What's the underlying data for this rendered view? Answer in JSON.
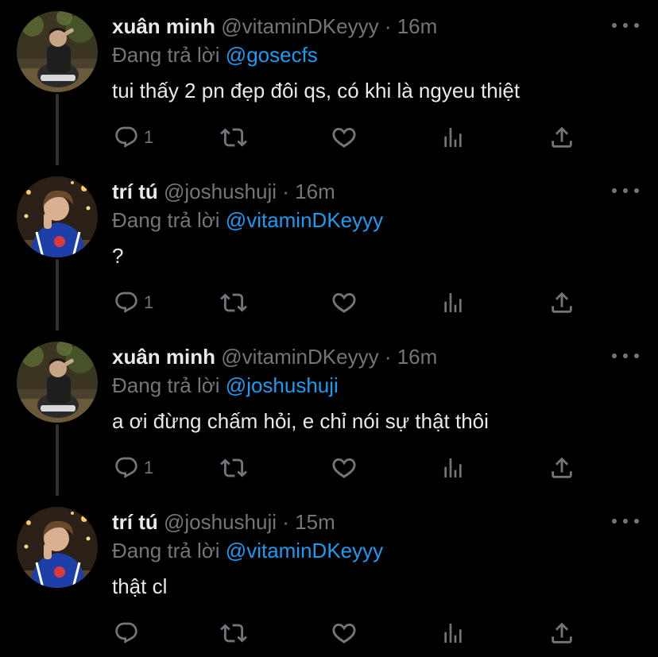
{
  "labels": {
    "replying_to": "Đang trả lời",
    "dot": "·"
  },
  "colors": {
    "background": "#000000",
    "accent": "#1d9bf0",
    "muted": "#71767b",
    "text": "#e7e9ea"
  },
  "tweets": [
    {
      "name": "xuân minh",
      "handle": "@vitaminDKeyyy",
      "time": "16m",
      "reply_to": "@gosecfs",
      "text": "tui thấy 2 pn đẹp đôi qs, có khi là ngyeu thiệt",
      "reply_count": "1"
    },
    {
      "name": "trí tú",
      "handle": "@joshushuji",
      "time": "16m",
      "reply_to": "@vitaminDKeyyy",
      "text": "?",
      "reply_count": "1"
    },
    {
      "name": "xuân minh",
      "handle": "@vitaminDKeyyy",
      "time": "16m",
      "reply_to": "@joshushuji",
      "text": "a ơi đừng chấm hỏi, e chỉ nói sự thật thôi",
      "reply_count": "1"
    },
    {
      "name": "trí tú",
      "handle": "@joshushuji",
      "time": "15m",
      "reply_to": "@vitaminDKeyyy",
      "text": "thật cl",
      "reply_count": ""
    }
  ],
  "icons": {
    "reply": "reply-icon",
    "retweet": "retweet-icon",
    "like": "heart-icon",
    "views": "views-icon",
    "share": "share-icon",
    "more": "more-icon"
  }
}
